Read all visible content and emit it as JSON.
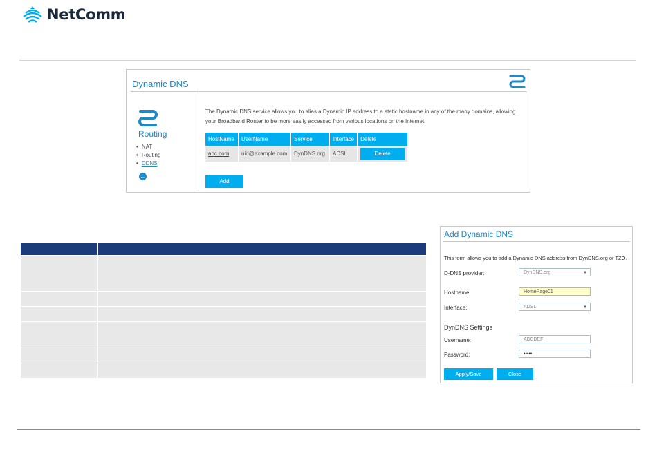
{
  "brand": {
    "name": "NetComm",
    "accent": "#00aef0",
    "header_color": "#1b3b7a"
  },
  "ddns_panel": {
    "title": "Dynamic DNS",
    "sidebar": {
      "title": "Routing",
      "items": [
        "NAT",
        "Routing",
        "DDNS"
      ],
      "back_icon": "arrow-left-circle-icon"
    },
    "description": "The Dynamic DNS service allows you to alias a Dynamic IP address to a static hostname in any of the many domains, allowing your Broadband Router to be more easily accessed from various locations on the Internet.",
    "table": {
      "headers": [
        "HostName",
        "UserName",
        "Service",
        "Interface",
        "Delete"
      ],
      "rows": [
        {
          "hostname": "abc.com",
          "username": "uid@example.com",
          "service": "DynDNS.org",
          "interface": "ADSL",
          "delete_label": "Delete"
        }
      ]
    },
    "add_label": "Add"
  },
  "add_dialog": {
    "title": "Add Dynamic DNS",
    "description": "This form allows you to add a Dynamic DNS address from DynDNS.org or TZO.",
    "provider": {
      "label": "D-DNS provider:",
      "value": "DynDNS.org"
    },
    "hostname": {
      "label": "Hostname:",
      "value": "HomePage01"
    },
    "interface": {
      "label": "Interface:",
      "value": "ADSL"
    },
    "settings_title": "DynDNS Settings",
    "username": {
      "label": "Username:",
      "value": "ABCDEF"
    },
    "password": {
      "label": "Password:",
      "value": "•••••"
    },
    "apply_label": "Apply/Save",
    "close_label": "Close"
  }
}
